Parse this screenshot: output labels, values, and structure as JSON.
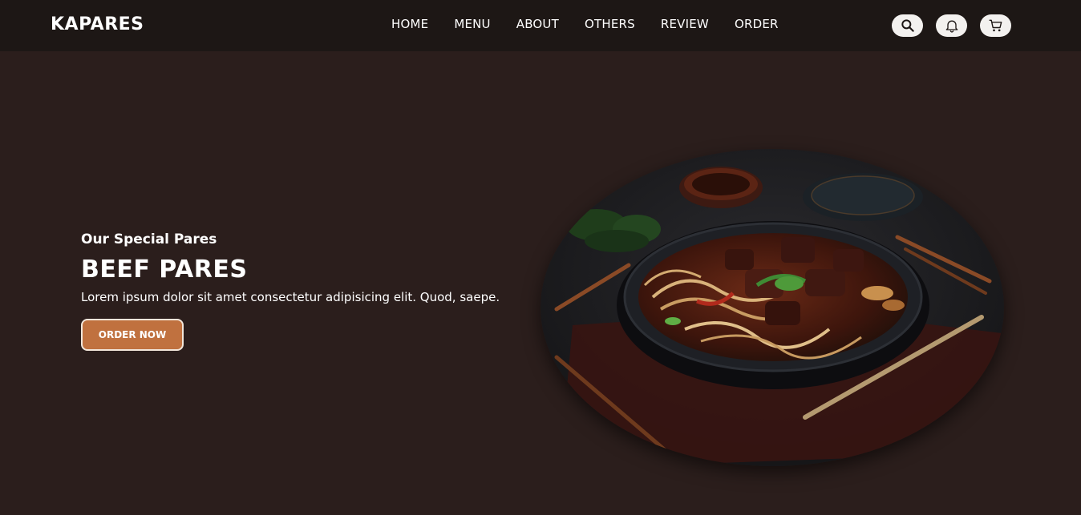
{
  "brand": {
    "logo": "KAPARES"
  },
  "nav": {
    "home": "HOME",
    "menu": "MENU",
    "about": "ABOUT",
    "others": "OTHERS",
    "review": "REVIEW",
    "order": "ORDER"
  },
  "icons": {
    "search": "search-icon",
    "bell": "bell-icon",
    "cart": "cart-icon"
  },
  "hero": {
    "subtitle": "Our Special Pares",
    "title": "BEEF PARES",
    "description": "Lorem ipsum dolor sit amet consectetur adipisicing elit. Quod, saepe.",
    "button_label": "ORDER NOW",
    "image_name": "beef-pares-bowl-image"
  },
  "colors": {
    "background": "#2b1e1c",
    "header": "#1d1715",
    "accent": "#c0713f",
    "text": "#ffffff"
  }
}
